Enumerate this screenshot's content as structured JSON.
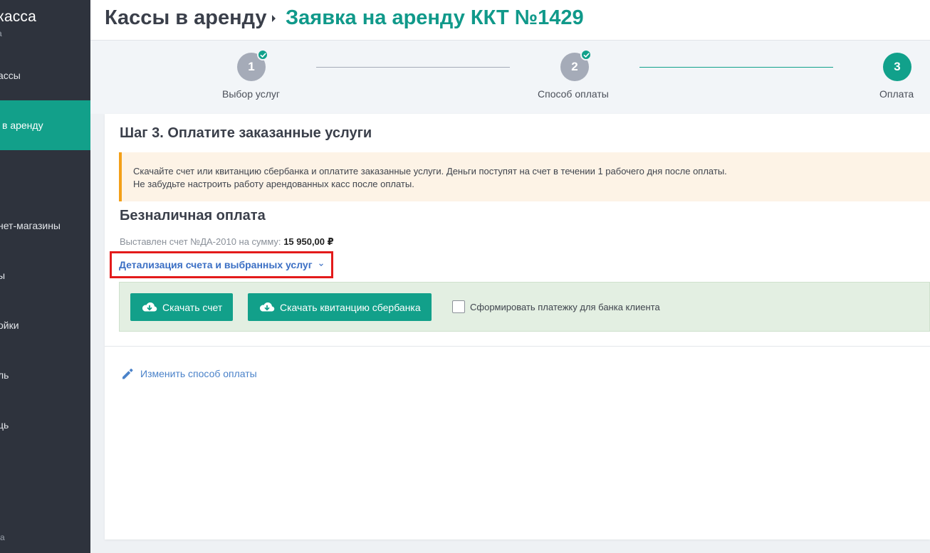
{
  "sidebar": {
    "brand": "касса",
    "brand_sub": "а",
    "items": [
      {
        "label": "ассы"
      },
      {
        "label": "в аренду"
      },
      {
        "label": "нет-магазины"
      },
      {
        "label": "ы"
      },
      {
        "label": "ойки"
      },
      {
        "label": "ль"
      },
      {
        "label": "ць"
      }
    ],
    "corner": "а"
  },
  "header": {
    "root": "Кассы в аренду",
    "current": "Заявка на аренду ККТ №1429"
  },
  "stepper": {
    "steps": [
      {
        "number": "1",
        "label": "Выбор услуг",
        "status": "done"
      },
      {
        "number": "2",
        "label": "Способ оплаты",
        "status": "done"
      },
      {
        "number": "3",
        "label": "Оплата",
        "status": "current"
      }
    ]
  },
  "card": {
    "title": "Шаг 3. Оплатите заказанные услуги",
    "notice_line1": "Скачайте счет или квитанцию сбербанка и оплатите заказанные услуги. Деньги поступят на счет в течении 1 рабочего дня после оплаты.",
    "notice_line2": "Не забудьте настроить работу арендованных касс после оплаты.",
    "section_title": "Безналичная оплата",
    "invoice_text": "Выставлен счет №ДА-2010 на сумму:",
    "invoice_amount": "15 950,00 ₽",
    "details_link": "Детализация счета и выбранных услуг",
    "download_invoice": "Скачать счет",
    "download_receipt": "Скачать квитанцию сбербанка",
    "bank_checkbox_label": "Сформировать платежку для банка клиента",
    "change_payment": "Изменить способ оплаты"
  },
  "colors": {
    "accent": "#12a08a",
    "sidebar_bg": "#2e333d",
    "link": "#3b6fc4",
    "highlight": "#e31b1b"
  }
}
